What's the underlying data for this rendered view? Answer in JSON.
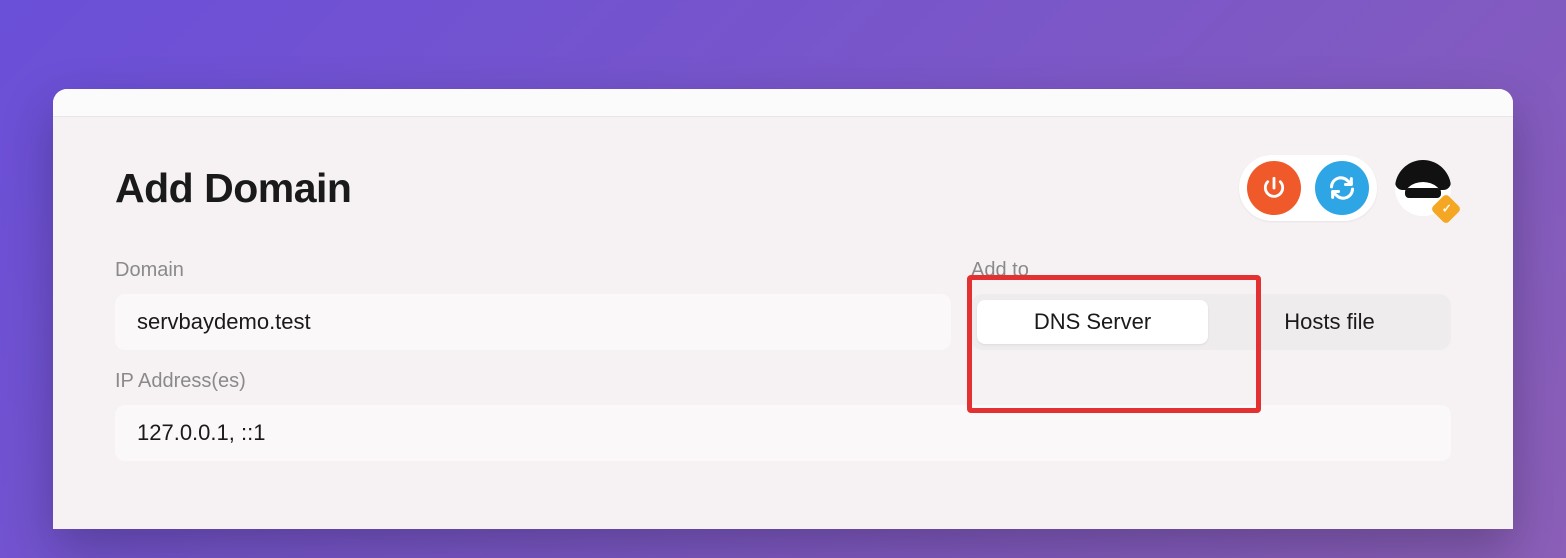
{
  "header": {
    "title": "Add Domain"
  },
  "actions": {
    "power_icon": "power-icon",
    "refresh_icon": "refresh-icon",
    "avatar": "avatar"
  },
  "form": {
    "domain_label": "Domain",
    "domain_value": "servbaydemo.test",
    "addto_label": "Add to",
    "addto_options": {
      "dns": "DNS Server",
      "hosts": "Hosts file"
    },
    "addto_selected": "dns",
    "ip_label": "IP Address(es)",
    "ip_value": "127.0.0.1, ::1"
  },
  "highlight": {
    "target": "addto-section"
  }
}
